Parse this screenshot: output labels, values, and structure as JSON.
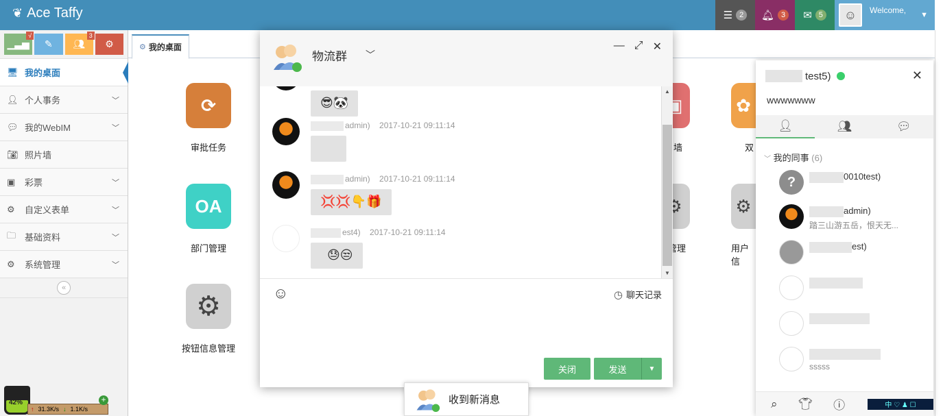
{
  "navbar": {
    "brand": "Ace Taffy",
    "tasks_count": "2",
    "notifications_count": "3",
    "messages_count": "5",
    "user_welcome": "Welcome,",
    "colors": {
      "bar": "#438eb9",
      "tasks": "#555555",
      "notifications": "#892e65",
      "messages": "#2e8965",
      "user": "#62a8d1"
    }
  },
  "sidebar": {
    "shortcuts": [
      {
        "icon": "signal-icon",
        "color": "#87b87f",
        "badge": "√"
      },
      {
        "icon": "pencil-icon",
        "color": "#6fb3e0",
        "badge": ""
      },
      {
        "icon": "users-icon",
        "color": "#ffb752",
        "badge": "3"
      },
      {
        "icon": "cogs-icon",
        "color": "#d15b47",
        "badge": ""
      }
    ],
    "items": [
      {
        "label": "我的桌面",
        "icon": "desktop-icon",
        "active": true
      },
      {
        "label": "个人事务",
        "icon": "user-icon"
      },
      {
        "label": "我的WebIM",
        "icon": "comments-icon"
      },
      {
        "label": "照片墙",
        "icon": "camera-icon"
      },
      {
        "label": "彩票",
        "icon": "money-icon"
      },
      {
        "label": "自定义表单",
        "icon": "cog-icon"
      },
      {
        "label": "基础资料",
        "icon": "folder-icon"
      },
      {
        "label": "系统管理",
        "icon": "cogs-icon"
      }
    ],
    "speed": {
      "percent": "42%",
      "up": "31.3K/s",
      "down": "1.1K/s"
    }
  },
  "main": {
    "tab_label": "我的桌面",
    "desktop_items": [
      {
        "label": "审批任务"
      },
      {
        "label": "部门管理",
        "icon_text": "OA"
      },
      {
        "label": "按钮信息管理"
      },
      {
        "label": "墙"
      },
      {
        "label": "管理"
      },
      {
        "label": "双"
      },
      {
        "label": "用户信"
      }
    ]
  },
  "chat": {
    "title": "物流群",
    "messages": [
      {
        "sender_suffix": "admin)",
        "time": "2017-10-21 09:11:14",
        "content": ""
      },
      {
        "sender_suffix": "admin)",
        "time": "2017-10-21 09:11:14",
        "content": ""
      },
      {
        "sender_suffix": "est4)",
        "time": "2017-10-21 09:11:14",
        "content": ""
      }
    ],
    "history_label": "聊天记录",
    "close_label": "关闭",
    "send_label": "发送"
  },
  "notify": {
    "text": "收到新消息"
  },
  "panel": {
    "user_suffix": "test5)",
    "sign": "wwwwwww",
    "group_name": "我的同事",
    "group_count": "(6)",
    "contacts": [
      {
        "name_suffix": "0010test)",
        "sign": ""
      },
      {
        "name_suffix": "admin)",
        "sign": "踏三山游五岳，恨天无..."
      },
      {
        "name_suffix": "est)",
        "sign": ""
      },
      {
        "name_suffix": "",
        "sign": ""
      },
      {
        "name_suffix": "",
        "sign": ""
      },
      {
        "name_suffix": "",
        "sign": "sssss"
      }
    ]
  }
}
